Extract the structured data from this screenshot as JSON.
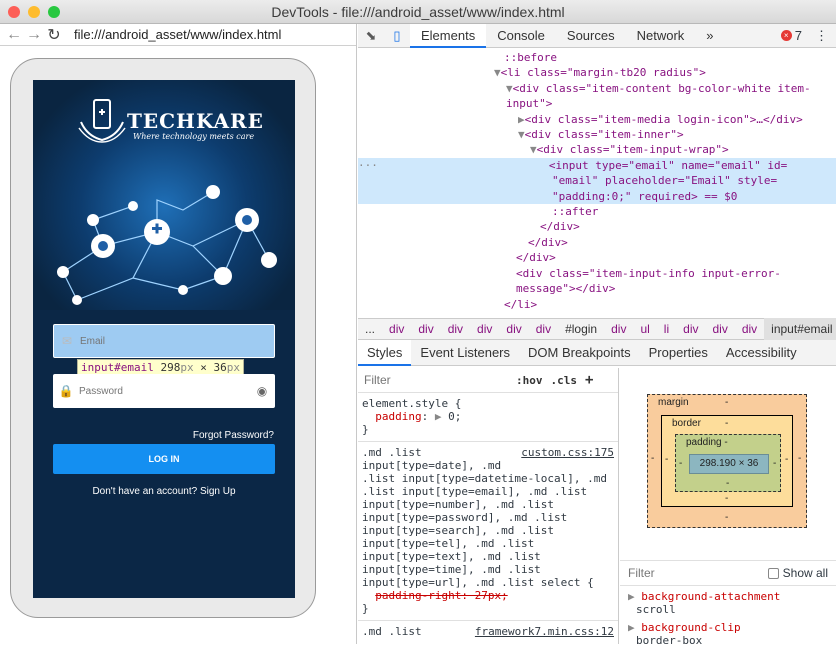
{
  "window": {
    "title": "DevTools - file:///android_asset/www/index.html"
  },
  "browser": {
    "url": "file:///android_asset/www/index.html"
  },
  "app": {
    "brand": "TECHKARE",
    "tagline": "Where technology meets care",
    "email_placeholder": "Email",
    "password_placeholder": "Password",
    "forgot": "Forgot Password?",
    "login": "LOG IN",
    "signup": "Don't have an account? Sign Up",
    "tooltip_tag": "input#email",
    "tooltip_size": "298",
    "tooltip_h": "36",
    "tooltip_unit": "px"
  },
  "devtools": {
    "tabs": [
      "Elements",
      "Console",
      "Sources",
      "Network"
    ],
    "more": "»",
    "error_count": "7",
    "tree": [
      "::before",
      "<li class=\"margin-tb20 radius\">",
      "<div class=\"item-content bg-color-white item-",
      "input\">",
      "<div class=\"item-media login-icon\">…</div>",
      "<div class=\"item-inner\">",
      "<div class=\"item-input-wrap\">",
      "<input type=\"email\" name=\"email\" id=",
      "\"email\" placeholder=\"Email\" style=",
      "\"padding:0;\" required> == $0",
      "::after",
      "</div>",
      "</div>",
      "</div>",
      "<div class=\"item-input-info input-error-",
      "message\"></div>",
      "</li>"
    ],
    "breadcrumbs": [
      "...",
      "div",
      "div",
      "div",
      "div",
      "div",
      "div",
      "#login",
      "div",
      "ul",
      "li",
      "div",
      "div",
      "div",
      "input#email"
    ],
    "sub_tabs": [
      "Styles",
      "Event Listeners",
      "DOM Breakpoints",
      "Properties",
      "Accessibility"
    ],
    "filter_placeholder": "Filter",
    "hov": ":hov",
    "cls": ".cls",
    "plus": "+",
    "element_style": {
      "selector": "element.style {",
      "prop": "padding",
      "value": "0;",
      "close": "}"
    },
    "rule2": {
      "source": "custom.css:175",
      "lines": [
        ".md .list",
        "input[type=date], .md",
        ".list input[type=datetime-local], .md",
        ".list input[type=email], .md .list",
        "input[type=number], .md .list",
        "input[type=password], .md .list",
        "input[type=search], .md .list",
        "input[type=tel], .md .list",
        "input[type=text], .md .list",
        "input[type=time], .md .list",
        "input[type=url], .md .list select {"
      ],
      "strike": "padding-right: 27px;",
      "close": "}"
    },
    "rule3": {
      "source": "framework7.min.css:12",
      "line": ".md .list"
    },
    "boxmodel": {
      "margin_label": "margin",
      "border_label": "border",
      "padding_label": "padding -",
      "content": "298.190 × 36",
      "dash": "-"
    },
    "computed": {
      "filter_placeholder": "Filter",
      "show_all": "Show all",
      "props": [
        {
          "name": "background-attachment",
          "value": "scroll"
        },
        {
          "name": "background-clip",
          "value": "border-box"
        }
      ]
    }
  }
}
